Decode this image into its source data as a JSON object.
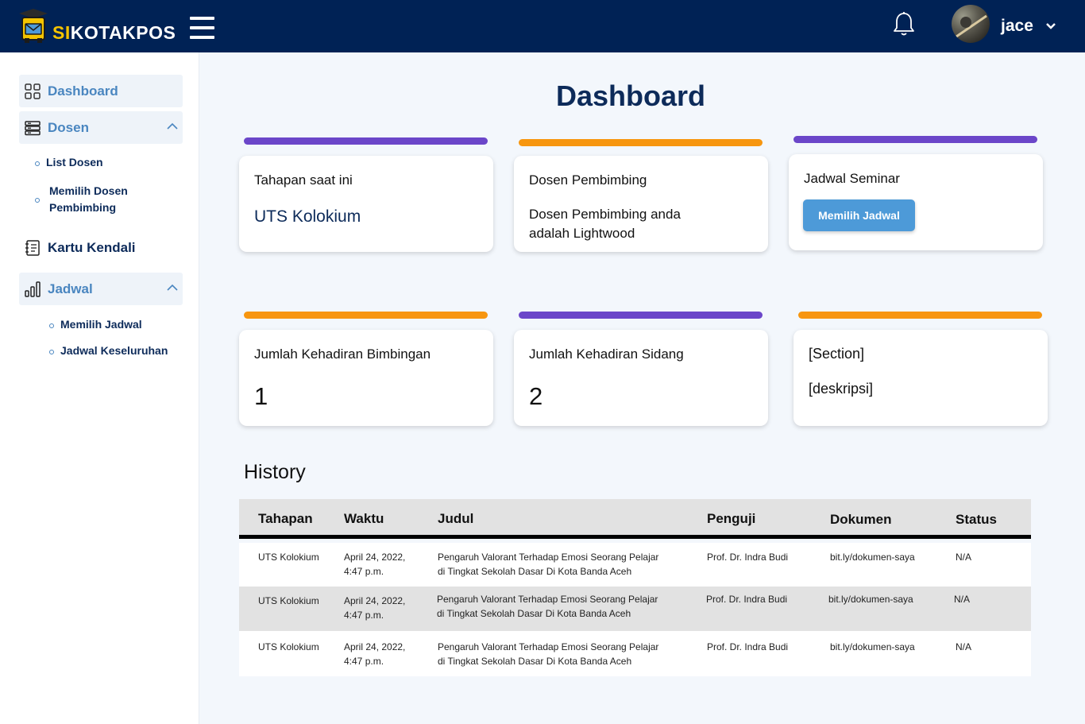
{
  "app": {
    "brand_si": "SI",
    "brand_rest": "KOTAKPOS"
  },
  "user": {
    "name": "jace"
  },
  "sidebar": {
    "dashboard": "Dashboard",
    "dosen": "Dosen",
    "dosen_sub": [
      "List Dosen",
      "Memilih Dosen",
      "Pembimbing"
    ],
    "kartu": "Kartu Kendali",
    "jadwal": "Jadwal",
    "jadwal_sub": [
      "Memilih Jadwal",
      "Jadwal Keseluruhan"
    ]
  },
  "main": {
    "title": "Dashboard",
    "cards": [
      {
        "title": "Tahapan saat ini",
        "value": "UTS Kolokium"
      },
      {
        "title": "Dosen Pembimbing",
        "value_line1": "Dosen Pembimbing anda",
        "value_line2": "adalah Lightwood"
      },
      {
        "title": "Jadwal Seminar",
        "button": "Memilih Jadwal"
      },
      {
        "title": "Jumlah Kehadiran Bimbingan",
        "value": "1"
      },
      {
        "title": "Jumlah Kehadiran Sidang",
        "value": "2"
      },
      {
        "title": "[Section]",
        "value": "[deskripsi]"
      }
    ]
  },
  "history": {
    "title": "History",
    "columns": [
      "Tahapan",
      "Waktu",
      "Judul",
      "Penguji",
      "Dokumen",
      "Status"
    ],
    "rows": [
      {
        "tahapan": "UTS Kolokium",
        "waktu1": "April 24, 2022,",
        "waktu2": "4:47 p.m.",
        "judul1": "Pengaruh Valorant Terhadap Emosi Seorang Pelajar",
        "judul2": "di Tingkat Sekolah Dasar Di Kota Banda Aceh",
        "penguji": "Prof. Dr. Indra Budi",
        "dokumen": "bit.ly/dokumen-saya",
        "status": "N/A"
      },
      {
        "tahapan": "UTS Kolokium",
        "waktu1": "April 24, 2022,",
        "waktu2": "4:47 p.m.",
        "judul1": "Pengaruh Valorant Terhadap Emosi Seorang Pelajar",
        "judul2": "di Tingkat Sekolah Dasar Di Kota Banda Aceh",
        "penguji": "Prof. Dr. Indra Budi",
        "dokumen": "bit.ly/dokumen-saya",
        "status": "N/A"
      },
      {
        "tahapan": "UTS Kolokium",
        "waktu1": "April 24, 2022,",
        "waktu2": "4:47 p.m.",
        "judul1": "Pengaruh Valorant Terhadap Emosi Seorang Pelajar",
        "judul2": "di Tingkat Sekolah Dasar Di Kota Banda Aceh",
        "penguji": "Prof. Dr. Indra Budi",
        "dokumen": "bit.ly/dokumen-saya",
        "status": "N/A"
      }
    ]
  },
  "colors": {
    "navy": "#002255",
    "purple": "#6b46c9",
    "orange": "#f7960f",
    "accent_blue": "#4a86c0",
    "button_blue": "#4d9ad8"
  }
}
